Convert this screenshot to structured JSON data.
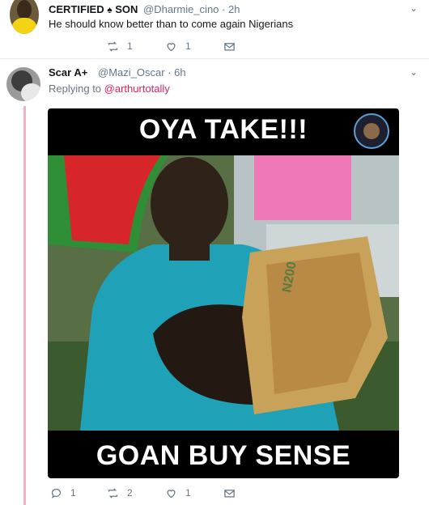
{
  "tweet1": {
    "display_name": "CERTIFIED",
    "name_suffix": "SON",
    "handle": "@Dharmie_cino",
    "time": "· 2h",
    "text": "He should know better than to come again Nigerians",
    "counts": {
      "retweets": "1",
      "likes": "1"
    }
  },
  "tweet2": {
    "display_name": "Scar A+",
    "handle": "@Mazi_Oscar",
    "time": "· 6h",
    "replying_prefix": "Replying to",
    "replying_to": "@arthurtotally",
    "meme": {
      "top_text": "OYA TAKE!!!",
      "bottom_text": "GOAN BUY SENSE"
    },
    "counts": {
      "replies": "1",
      "retweets": "2",
      "likes": "1"
    }
  },
  "colors": {
    "thread_line": "#f4b0c3",
    "link": "#e0245e",
    "muted": "#657786"
  },
  "icons": [
    "spade-icon",
    "chevron-down-icon",
    "reply-icon",
    "retweet-icon",
    "like-icon",
    "message-icon"
  ]
}
